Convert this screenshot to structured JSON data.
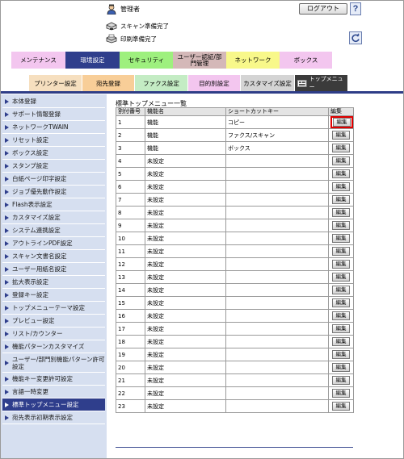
{
  "header": {
    "user_label": "管理者",
    "logout_label": "ログアウト",
    "help_label": "?",
    "status_scan": "スキャン準備完了",
    "status_print": "印刷準備完了"
  },
  "tabs_primary": [
    {
      "label": "メンテナンス",
      "bg": "#f3c6ef",
      "fg": "#000000"
    },
    {
      "label": "環境設定",
      "bg": "#2f3e8c",
      "fg": "#ffffff"
    },
    {
      "label": "セキュリティ",
      "bg": "#9ef07e",
      "fg": "#000000"
    },
    {
      "label": "ユーザー認証/部門管理",
      "bg": "#d4b8b8",
      "fg": "#000000"
    },
    {
      "label": "ネットワーク",
      "bg": "#f8f88a",
      "fg": "#000000"
    },
    {
      "label": "ボックス",
      "bg": "#f3c6ef",
      "fg": "#000000"
    }
  ],
  "tabs_secondary": [
    {
      "label": "プリンター設定",
      "bg": "#f6dfbf"
    },
    {
      "label": "宛先登録",
      "bg": "#f8ce98"
    },
    {
      "label": "ファクス設定",
      "bg": "#c4ecc4"
    },
    {
      "label": "目的別設定",
      "bg": "#f3c6ef"
    },
    {
      "label": "カスタマイズ設定",
      "bg": "#d4d4d4"
    },
    {
      "label": "トップメニュー",
      "bg": "#3b3b3b"
    }
  ],
  "sidebar": {
    "items": [
      {
        "label": "本体登録"
      },
      {
        "label": "サポート情報登録"
      },
      {
        "label": "ネットワークTWAIN"
      },
      {
        "label": "リセット設定"
      },
      {
        "label": "ボックス設定"
      },
      {
        "label": "スタンプ設定"
      },
      {
        "label": "白紙ページ印字設定"
      },
      {
        "label": "ジョブ優先動作設定"
      },
      {
        "label": "Flash表示設定"
      },
      {
        "label": "カスタマイズ設定"
      },
      {
        "label": "システム連携設定"
      },
      {
        "label": "アウトラインPDF設定"
      },
      {
        "label": "スキャン文書名設定"
      },
      {
        "label": "ユーザー用紙名設定"
      },
      {
        "label": "拡大表示設定"
      },
      {
        "label": "登録キー設定"
      },
      {
        "label": "トップメニューテーマ設定"
      },
      {
        "label": "プレビュー設定"
      },
      {
        "label": "リスト/カウンター"
      },
      {
        "label": "機能パターンカスタマイズ"
      },
      {
        "label": "ユーザー/部門別機能パターン許可設定"
      },
      {
        "label": "機能キー変更許可設定"
      },
      {
        "label": "言語一時変更"
      },
      {
        "label": "標準トップメニュー設定"
      },
      {
        "label": "宛先表示初期表示設定"
      }
    ],
    "active_index": 23
  },
  "main": {
    "title": "標準トップメニュー一覧",
    "columns": [
      "割付番号",
      "機能名",
      "ショートカットキー",
      "編集"
    ],
    "edit_label": "編集",
    "rows": [
      {
        "no": "1",
        "name": "機能",
        "key": "コピー"
      },
      {
        "no": "2",
        "name": "機能",
        "key": "ファクス/スキャン"
      },
      {
        "no": "3",
        "name": "機能",
        "key": "ボックス"
      },
      {
        "no": "4",
        "name": "未設定",
        "key": ""
      },
      {
        "no": "5",
        "name": "未設定",
        "key": ""
      },
      {
        "no": "6",
        "name": "未設定",
        "key": ""
      },
      {
        "no": "7",
        "name": "未設定",
        "key": ""
      },
      {
        "no": "8",
        "name": "未設定",
        "key": ""
      },
      {
        "no": "9",
        "name": "未設定",
        "key": ""
      },
      {
        "no": "10",
        "name": "未設定",
        "key": ""
      },
      {
        "no": "11",
        "name": "未設定",
        "key": ""
      },
      {
        "no": "12",
        "name": "未設定",
        "key": ""
      },
      {
        "no": "13",
        "name": "未設定",
        "key": ""
      },
      {
        "no": "14",
        "name": "未設定",
        "key": ""
      },
      {
        "no": "15",
        "name": "未設定",
        "key": ""
      },
      {
        "no": "16",
        "name": "未設定",
        "key": ""
      },
      {
        "no": "17",
        "name": "未設定",
        "key": ""
      },
      {
        "no": "18",
        "name": "未設定",
        "key": ""
      },
      {
        "no": "19",
        "name": "未設定",
        "key": ""
      },
      {
        "no": "20",
        "name": "未設定",
        "key": ""
      },
      {
        "no": "21",
        "name": "未設定",
        "key": ""
      },
      {
        "no": "22",
        "name": "未設定",
        "key": ""
      },
      {
        "no": "23",
        "name": "未設定",
        "key": ""
      }
    ]
  }
}
